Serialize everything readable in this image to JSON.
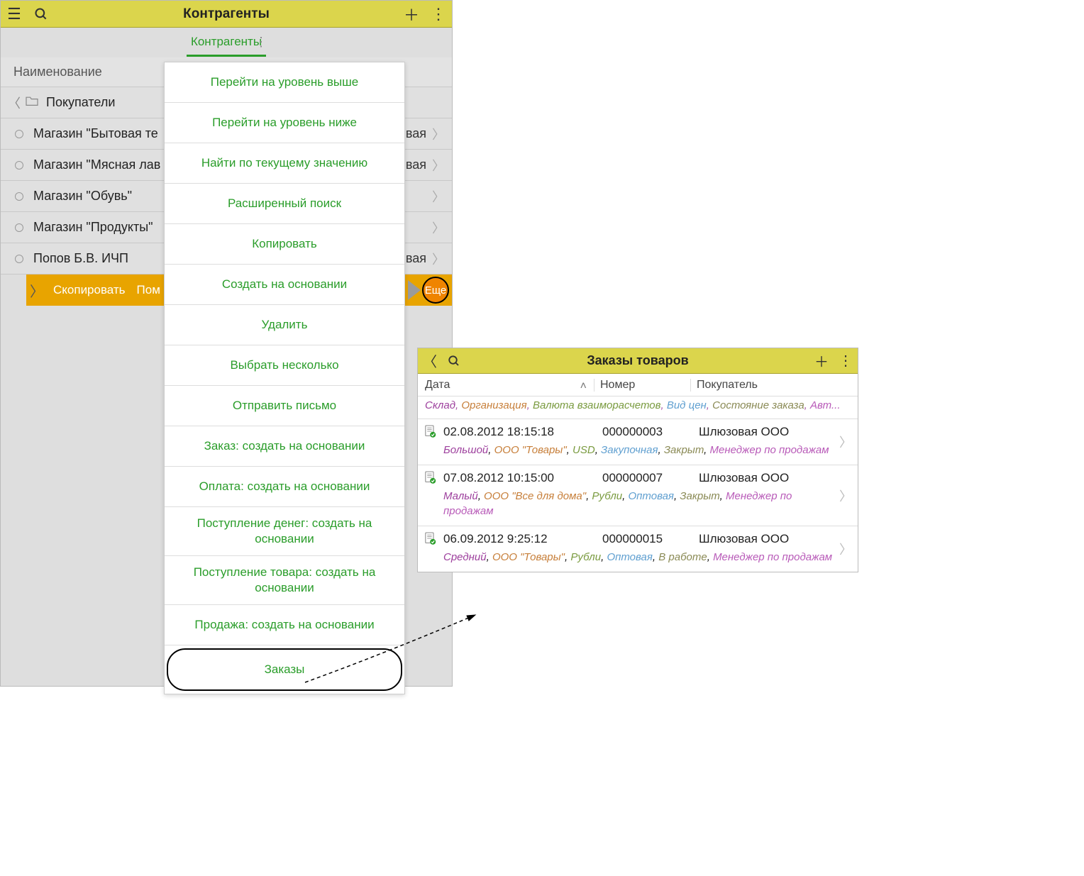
{
  "left": {
    "title": "Контрагенты",
    "tab": "Контрагенты",
    "section": "Наименование",
    "folder": "Покупатели",
    "rows": [
      {
        "name": "Магазин \"Бытовая те",
        "tail": "вая"
      },
      {
        "name": "Магазин \"Мясная лав",
        "tail": "вая"
      },
      {
        "name": "Магазин \"Обувь\"",
        "tail": ""
      },
      {
        "name": "Магазин \"Продукты\"",
        "tail": ""
      },
      {
        "name": "Попов Б.В. ИЧП",
        "tail": "вая"
      }
    ],
    "actionbar": {
      "copy": "Скопировать",
      "mark": "Пом",
      "more": "Еще"
    },
    "ctx": [
      "Перейти на уровень выше",
      "Перейти на уровень ниже",
      "Найти по текущему значению",
      "Расширенный поиск",
      "Копировать",
      "Создать на основании",
      "Удалить",
      "Выбрать несколько",
      "Отправить письмо",
      "Заказ: создать на основании",
      "Оплата: создать на основании",
      "Поступление денег: создать на основании",
      "Поступление товара: создать на основании",
      "Продажа: создать на основании",
      "Заказы"
    ]
  },
  "right": {
    "title": "Заказы товаров",
    "cols": {
      "c1": "Дата",
      "c2": "Номер",
      "c3": "Покупатель"
    },
    "meta": {
      "sklad": "Склад",
      "org": "Организация",
      "val": "Валюта взаиморасчетов",
      "vid": "Вид цен",
      "stat": "Состояние заказа",
      "avt": "Авт..."
    },
    "orders": [
      {
        "date": "02.08.2012 18:15:18",
        "num": "000000003",
        "cust": "Шлюзовая ООО",
        "sub_sklad": "Большой",
        "sub_org": "ООО \"Товары\"",
        "sub_val": "USD",
        "sub_vid": "Закупочная",
        "sub_stat": "Закрыт",
        "sub_avt": "Менеджер по продажам"
      },
      {
        "date": "07.08.2012 10:15:00",
        "num": "000000007",
        "cust": "Шлюзовая ООО",
        "sub_sklad": "Малый",
        "sub_org": "ООО \"Все для дома\"",
        "sub_val": "Рубли",
        "sub_vid": "Оптовая",
        "sub_stat": "Закрыт",
        "sub_avt": "Менеджер по продажам"
      },
      {
        "date": "06.09.2012 9:25:12",
        "num": "000000015",
        "cust": "Шлюзовая ООО",
        "sub_sklad": "Средний",
        "sub_org": "ООО \"Товары\"",
        "sub_val": "Рубли",
        "sub_vid": "Оптовая",
        "sub_stat": "В работе",
        "sub_avt": "Менеджер по продажам"
      }
    ]
  }
}
